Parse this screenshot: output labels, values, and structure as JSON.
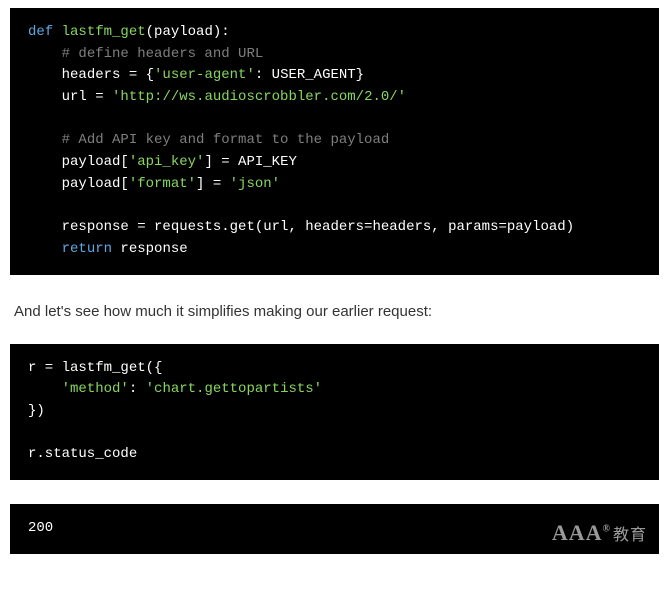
{
  "block1": {
    "l1_def": "def",
    "l1_fn": "lastfm_get",
    "l1_rest": "(payload):",
    "l2_cmt": "# define headers and URL",
    "l3_a": "headers = {",
    "l3_str": "'user-agent'",
    "l3_b": ": USER_AGENT}",
    "l4_a": "url = ",
    "l4_str": "'http://ws.audioscrobbler.com/2.0/'",
    "l6_cmt": "# Add API key and format to the payload",
    "l7_a": "payload[",
    "l7_str": "'api_key'",
    "l7_b": "] = API_KEY",
    "l8_a": "payload[",
    "l8_str": "'format'",
    "l8_b": "] = ",
    "l8_str2": "'json'",
    "l10": "response = requests.get(url, headers=headers, params=payload)",
    "l11_kw": "return",
    "l11_rest": " response"
  },
  "prose1": "And let's see how much it simplifies making our earlier request:",
  "block2": {
    "l1": "r = lastfm_get({",
    "l2_key": "'method'",
    "l2_sep": ": ",
    "l2_val": "'chart.gettopartists'",
    "l3": "})",
    "l5": "r.status_code"
  },
  "block3": {
    "out": "200"
  },
  "watermark": {
    "brand": "AAA",
    "reg": "®",
    "cjk": "教育"
  }
}
